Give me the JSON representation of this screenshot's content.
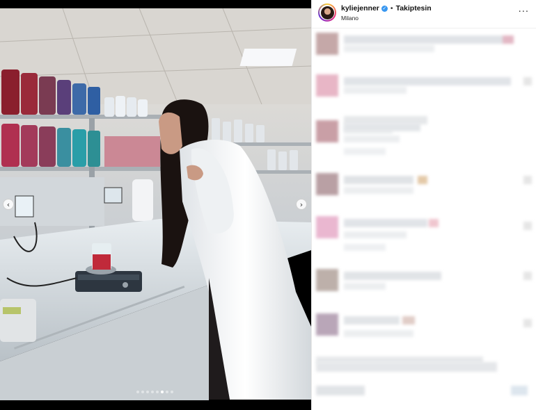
{
  "post": {
    "username": "kyliejenner",
    "follow_status": "Takiptesin",
    "separator": "•",
    "location": "Milano"
  },
  "carousel": {
    "prev_glyph": "‹",
    "next_glyph": "›",
    "total_slides": 8,
    "active_slide_index": 5
  },
  "icons": {
    "avatar": "avatar-icon",
    "verified": "verified-badge-icon",
    "more": "more-options-icon",
    "carousel_prev": "chevron-left-icon",
    "carousel_next": "chevron-right-icon"
  },
  "ui": {
    "more_glyph": "···",
    "verified_glyph": "✓"
  },
  "colors": {
    "verified_blue": "#3897f0",
    "lab_coat": "#f2f4f6",
    "pigment_red": "#c02a3a"
  }
}
